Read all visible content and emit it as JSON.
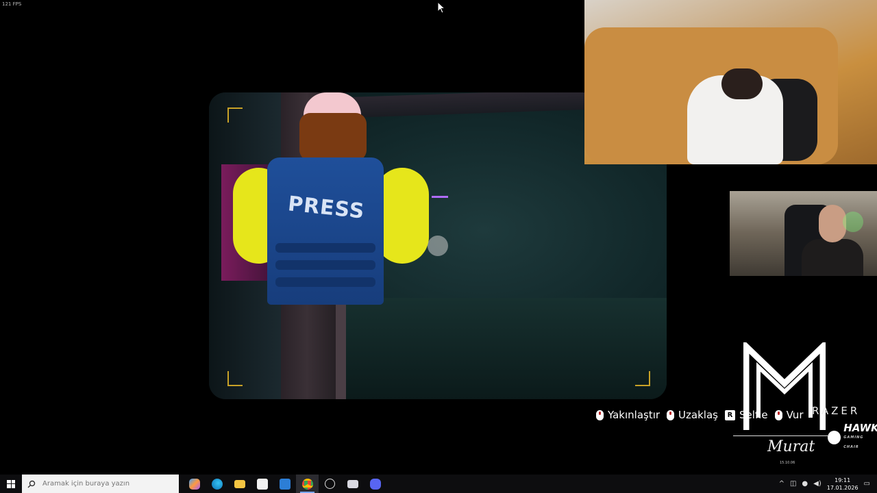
{
  "fps_overlay": "121 FPS",
  "game": {
    "vest_text": "PRESS",
    "controls": [
      {
        "icon": "mouse-icon",
        "label": "Yakınlaştır"
      },
      {
        "icon": "mouse-icon",
        "label": "Uzaklaş"
      },
      {
        "icon": "r-key-icon",
        "key": "R",
        "label": "Selfie"
      },
      {
        "icon": "mouse-icon",
        "label": "Vur"
      }
    ]
  },
  "branding": {
    "sponsor1": "RAZER",
    "sponsor2": "HAWK",
    "sponsor2_sub": "GAMING CHAIR",
    "signature": "Murat",
    "signature_date": "15.10.06"
  },
  "taskbar": {
    "search_placeholder": "Aramak için buraya yazın",
    "time": "19:11",
    "date": "17.01.2026",
    "apps": [
      "copilot-icon",
      "edge-icon",
      "file-explorer-icon",
      "store-icon",
      "mail-icon",
      "chrome-icon",
      "obs-icon",
      "file-icon",
      "discord-icon"
    ]
  },
  "colors": {
    "viewfinder_corner": "#c9a227",
    "vest": "#1f4f9a",
    "shirt": "#e6e61b",
    "taskbar": "#0d0d0f"
  }
}
